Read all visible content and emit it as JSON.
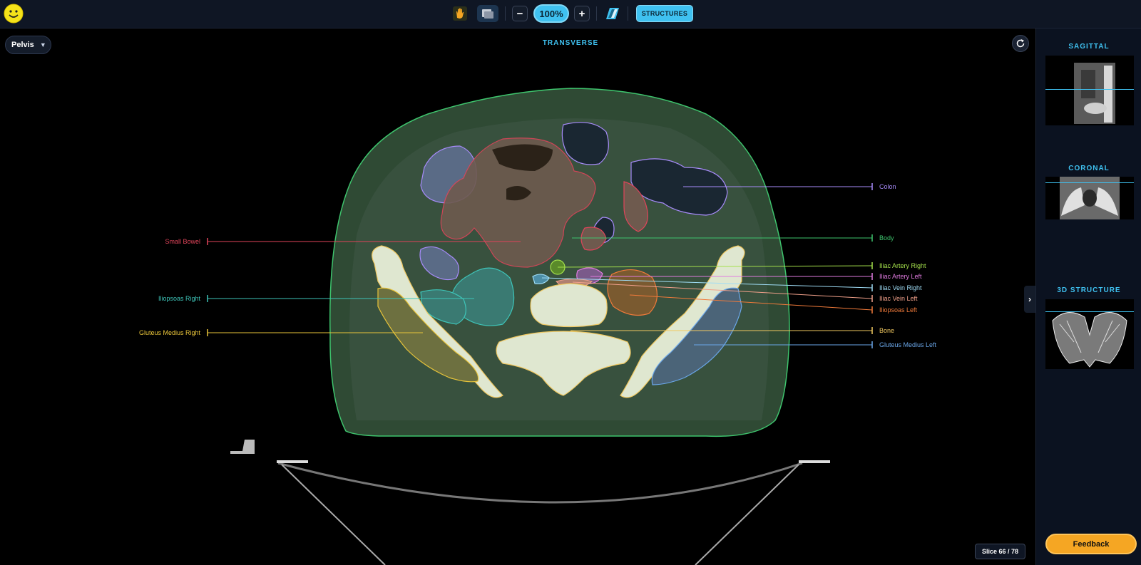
{
  "toolbar": {
    "zoom": "100%",
    "zoom_out": "−",
    "zoom_in": "+",
    "structures": "STRUCTURES"
  },
  "viewer": {
    "region": "Pelvis",
    "view_title": "TRANSVERSE",
    "slice": "Slice 66 / 78"
  },
  "right_panel": {
    "sagittal": "SAGITTAL",
    "coronal": "CORONAL",
    "structure3d": "3D STRUCTURE",
    "feedback": "Feedback"
  },
  "structures": [
    {
      "name": "Colon",
      "color": "#a78bfa"
    },
    {
      "name": "Body",
      "color": "#3ec46d"
    },
    {
      "name": "Iliac Artery Right",
      "color": "#a4e04b"
    },
    {
      "name": "Iliac Artery Left",
      "color": "#e07be0"
    },
    {
      "name": "Iliac Vein Right",
      "color": "#9fdcf5"
    },
    {
      "name": "Iliac Vein Left",
      "color": "#f0a08a"
    },
    {
      "name": "Iliopsoas Left",
      "color": "#f07a3a"
    },
    {
      "name": "Bone",
      "color": "#f0c860"
    },
    {
      "name": "Gluteus Medius Left",
      "color": "#6aa6e8"
    },
    {
      "name": "Small Bowel",
      "color": "#e0445a"
    },
    {
      "name": "Iliopsoas Right",
      "color": "#3ec4b8"
    },
    {
      "name": "Gluteus Medius Right",
      "color": "#e8c43a"
    }
  ]
}
